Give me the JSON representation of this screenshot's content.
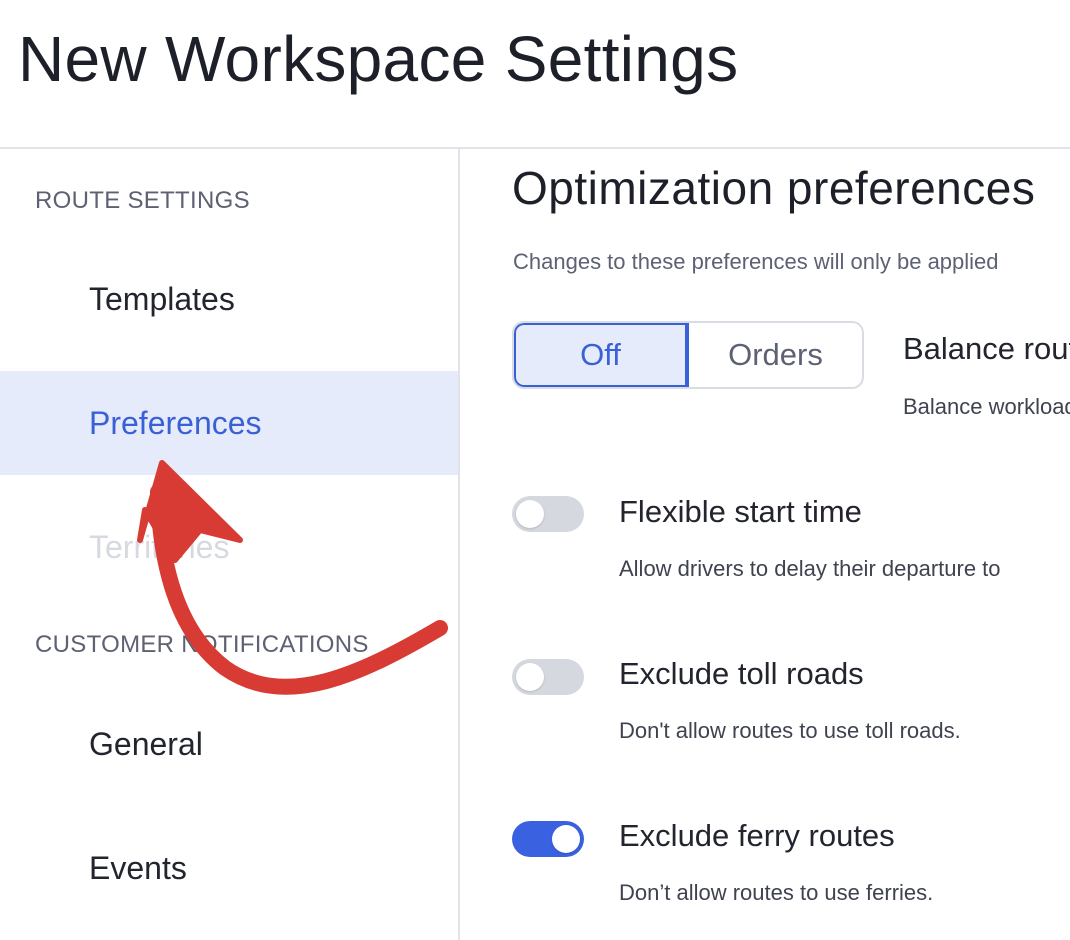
{
  "page": {
    "title": "New Workspace Settings"
  },
  "sidebar": {
    "sections": [
      {
        "label": "ROUTE SETTINGS"
      },
      {
        "label": "CUSTOMER NOTIFICATIONS"
      }
    ],
    "items": [
      {
        "label": "Templates",
        "state": "default"
      },
      {
        "label": "Preferences",
        "state": "active"
      },
      {
        "label": "Territories",
        "state": "disabled"
      },
      {
        "label": "General",
        "state": "default"
      },
      {
        "label": "Events",
        "state": "default"
      }
    ]
  },
  "main": {
    "title": "Optimization preferences",
    "subtitle": "Changes to these preferences will only be applied",
    "balance": {
      "segments": [
        "Off",
        "Orders"
      ],
      "selected": "Off",
      "title": "Balance routes",
      "description": "Balance workload"
    },
    "options": [
      {
        "title": "Flexible start time",
        "description": "Allow drivers to delay their departure to",
        "enabled": false
      },
      {
        "title": "Exclude toll roads",
        "description": "Don't allow routes to use toll roads.",
        "enabled": false
      },
      {
        "title": "Exclude ferry routes",
        "description": "Don’t allow routes to use ferries.",
        "enabled": true
      }
    ]
  },
  "colors": {
    "accent": "#3a60d6",
    "active_bg": "#e6ebfb",
    "annotation_arrow": "#d83a34"
  },
  "icons": {
    "annotation": "curved-arrow-icon"
  }
}
